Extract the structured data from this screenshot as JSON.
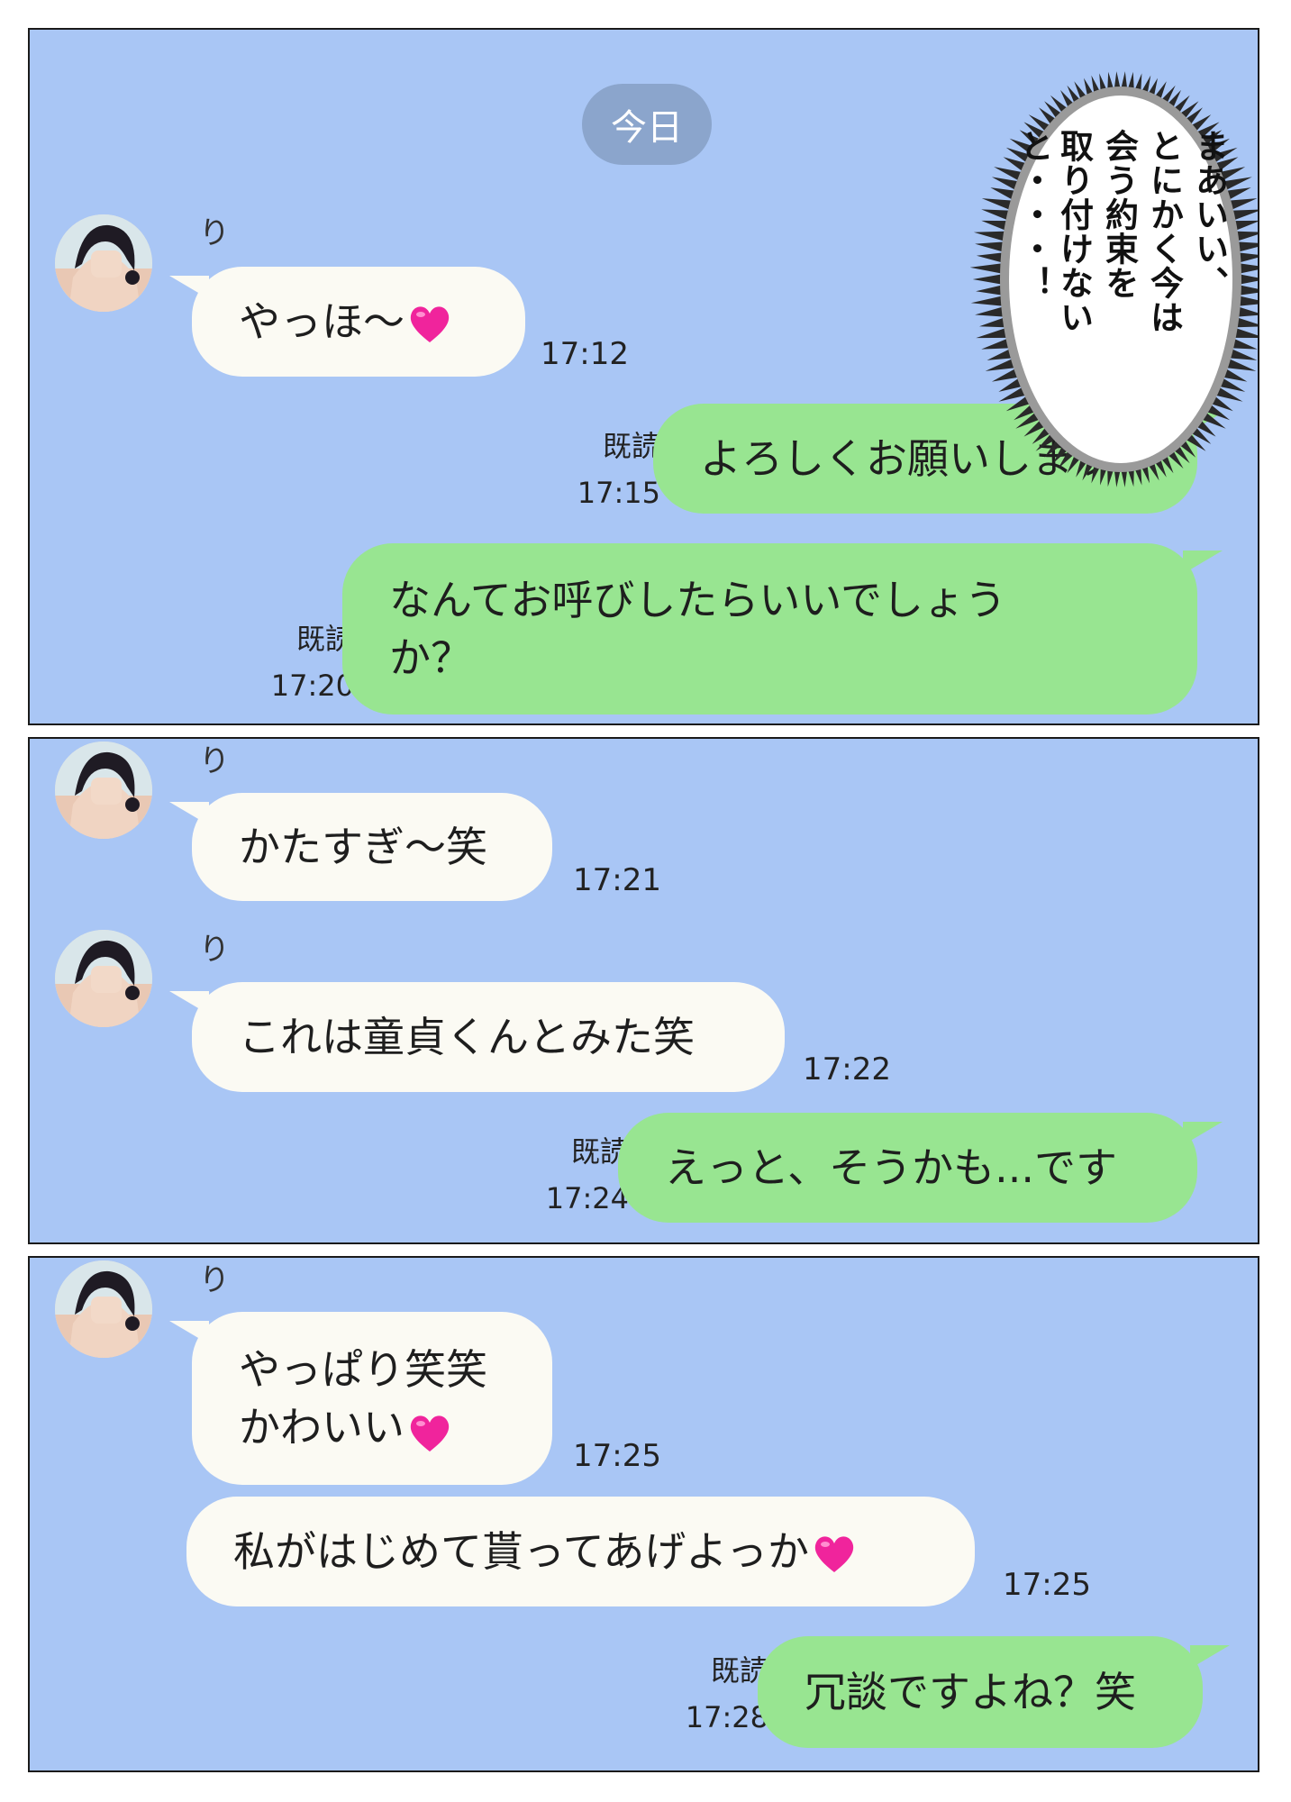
{
  "date_label": "今日",
  "contact_name": "り",
  "read_label": "既読",
  "thought_bubble": {
    "lines": [
      "まあいい、",
      "とにかく今は",
      "会う約束を",
      "取り付けないと・・・！"
    ]
  },
  "messages": [
    {
      "id": "m1",
      "text": "やっほ〜",
      "time": "17:12",
      "heart": true
    },
    {
      "id": "m2",
      "text": "よろしくお願いします",
      "time": "17:15"
    },
    {
      "id": "m3",
      "lines": [
        "なんてお呼びしたらいいでしょう",
        "か？"
      ],
      "time": "17:20"
    },
    {
      "id": "m4",
      "text": "かたすぎ〜笑",
      "time": "17:21"
    },
    {
      "id": "m5",
      "text": "これは童貞くんとみた笑",
      "time": "17:22"
    },
    {
      "id": "m6",
      "text": "えっと、そうかも...です",
      "time": "17:24"
    },
    {
      "id": "m7",
      "lines": [
        "やっぱり笑笑",
        "かわいい"
      ],
      "time": "17:25",
      "heart": true
    },
    {
      "id": "m8",
      "text": "私がはじめて貰ってあげよっか",
      "time": "17:25",
      "heart": true
    },
    {
      "id": "m9",
      "text": "冗談ですよね？笑",
      "time": "17:28"
    }
  ],
  "colors": {
    "background": "#a9c6f5",
    "incoming": "#fbfaf3",
    "outgoing": "#98e591",
    "date_pill": "#8ba5cc",
    "heart": "#f0249c"
  }
}
